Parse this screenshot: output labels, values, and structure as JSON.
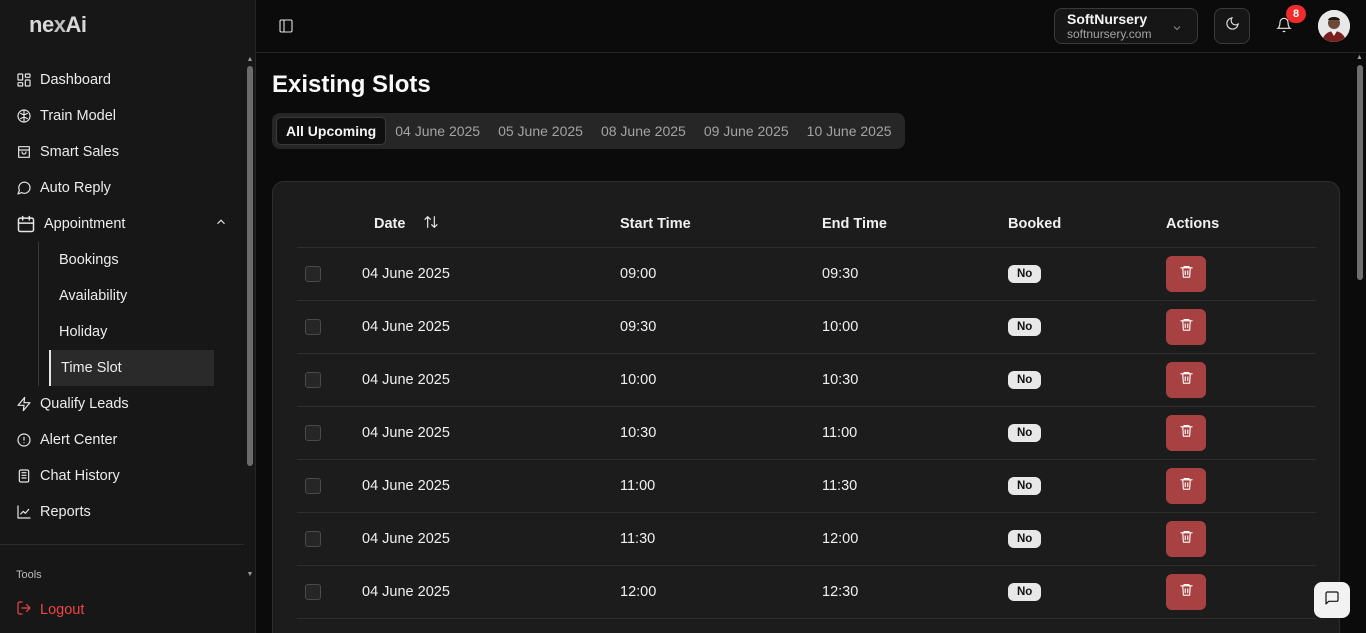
{
  "app": {
    "logo": "nexAi"
  },
  "sidebar": {
    "items": [
      {
        "label": "Dashboard",
        "icon": "dashboard-icon"
      },
      {
        "label": "Train Model",
        "icon": "brain-icon"
      },
      {
        "label": "Smart Sales",
        "icon": "shopping-bag-icon"
      },
      {
        "label": "Auto Reply",
        "icon": "message-circle-icon"
      },
      {
        "label": "Appointment",
        "icon": "calendar-icon",
        "expanded": true
      }
    ],
    "sub_items": [
      {
        "label": "Bookings"
      },
      {
        "label": "Availability"
      },
      {
        "label": "Holiday"
      },
      {
        "label": "Time Slot",
        "active": true
      }
    ],
    "items_after": [
      {
        "label": "Qualify Leads",
        "icon": "zap-icon"
      },
      {
        "label": "Alert Center",
        "icon": "alert-circle-icon"
      },
      {
        "label": "Chat History",
        "icon": "chat-history-icon"
      },
      {
        "label": "Reports",
        "icon": "chart-line-icon"
      }
    ],
    "section_label": "Tools",
    "logout_label": "Logout"
  },
  "header": {
    "workspace_name": "SoftNursery",
    "workspace_domain": "softnursery.com",
    "notification_count": "8"
  },
  "main": {
    "title": "Existing Slots",
    "tabs": [
      {
        "label": "All Upcoming",
        "active": true
      },
      {
        "label": "04 June 2025"
      },
      {
        "label": "05 June 2025"
      },
      {
        "label": "08 June 2025"
      },
      {
        "label": "09 June 2025"
      },
      {
        "label": "10 June 2025"
      }
    ],
    "table": {
      "columns": [
        "Date",
        "Start Time",
        "End Time",
        "Booked",
        "Actions"
      ],
      "rows": [
        {
          "date": "04 June 2025",
          "start": "09:00",
          "end": "09:30",
          "booked": "No"
        },
        {
          "date": "04 June 2025",
          "start": "09:30",
          "end": "10:00",
          "booked": "No"
        },
        {
          "date": "04 June 2025",
          "start": "10:00",
          "end": "10:30",
          "booked": "No"
        },
        {
          "date": "04 June 2025",
          "start": "10:30",
          "end": "11:00",
          "booked": "No"
        },
        {
          "date": "04 June 2025",
          "start": "11:00",
          "end": "11:30",
          "booked": "No"
        },
        {
          "date": "04 June 2025",
          "start": "11:30",
          "end": "12:00",
          "booked": "No"
        },
        {
          "date": "04 June 2025",
          "start": "12:00",
          "end": "12:30",
          "booked": "No"
        }
      ]
    }
  },
  "colors": {
    "danger": "#a84242",
    "logout": "#ef4444",
    "badge": "#ef2b2b"
  }
}
